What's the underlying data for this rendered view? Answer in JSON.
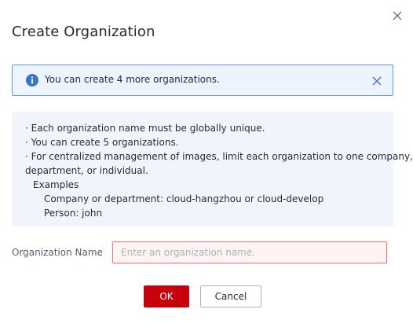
{
  "dialog": {
    "title": "Create Organization",
    "close_icon": "close-icon"
  },
  "banner": {
    "icon": "info-icon",
    "text": "You can create 4 more organizations.",
    "close_icon": "close-icon",
    "accent_color": "#3f73c8"
  },
  "rules": {
    "line1": "· Each organization name must be globally unique.",
    "line2": "· You can create 5 organizations.",
    "line3": "· For centralized management of images, limit each organization to one company,",
    "line4": "department, or individual.",
    "examples_heading": "Examples",
    "example1": "Company or department: cloud-hangzhou or cloud-develop",
    "example2": "Person: john"
  },
  "form": {
    "name_label": "Organization Name",
    "name_value": "",
    "name_placeholder": "Enter an organization name."
  },
  "footer": {
    "ok_label": "OK",
    "cancel_label": "Cancel",
    "primary_color": "#c7000b"
  }
}
